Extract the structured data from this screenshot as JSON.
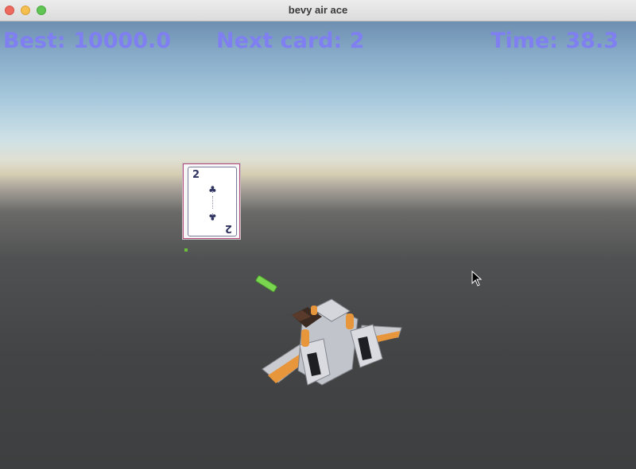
{
  "window": {
    "title": "bevy air ace"
  },
  "hud": {
    "best": "Best: 10000.0",
    "next_card": "Next card: 2",
    "time": "Time: 38.3"
  },
  "card": {
    "rank": "2",
    "suit": "clubs",
    "pip_symbol": "♣"
  },
  "scene": {
    "player": "aircraft",
    "projectile": "bullet",
    "hud_color": "#7f7ff2",
    "bullet_color": "#7bd64f",
    "ship_body_color": "#c7c9d0",
    "ship_accent_color": "#e8963c"
  },
  "icons": {
    "pointer": "mouse-cursor-icon"
  }
}
